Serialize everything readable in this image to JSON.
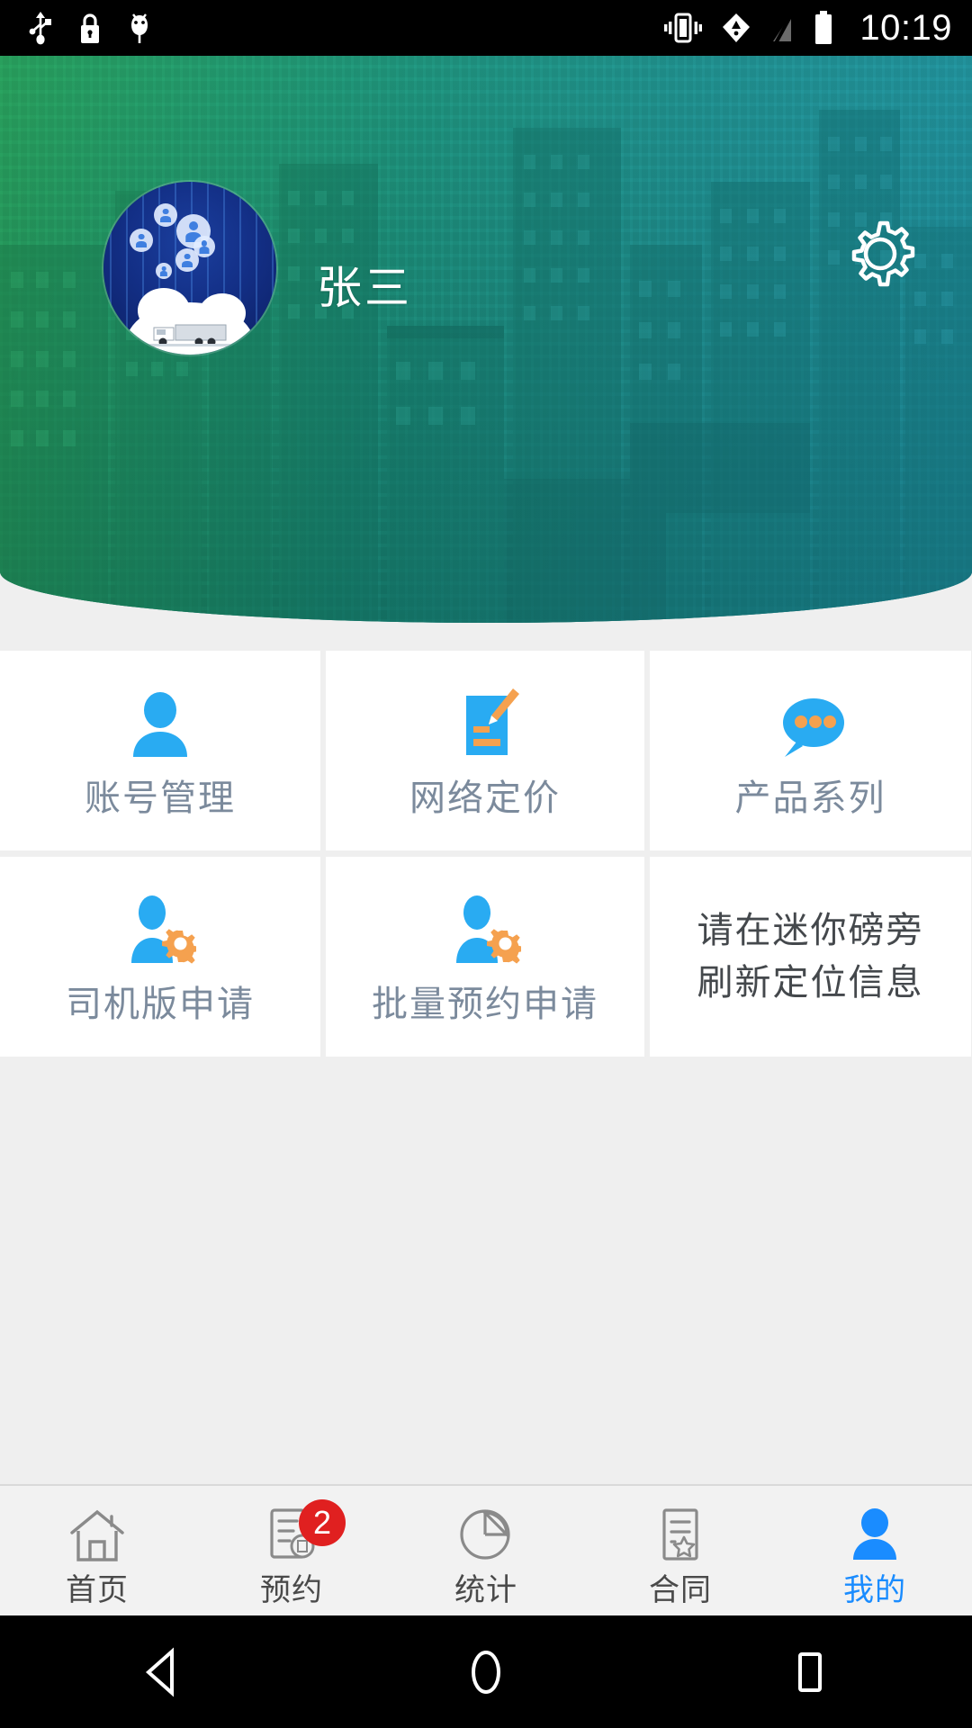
{
  "statusbar": {
    "time": "10:19",
    "left_icons": [
      "usb-icon",
      "lock-icon",
      "android-debug-icon"
    ],
    "right_icons": [
      "vibrate-icon",
      "wifi-icon",
      "signal-off-icon",
      "battery-icon"
    ]
  },
  "header": {
    "username": "张三",
    "avatar_name": "user-avatar",
    "settings_icon": "gear-icon",
    "gradient_from": "#20b05f",
    "gradient_to": "#20a0ba"
  },
  "grid": {
    "items": [
      {
        "label": "账号管理",
        "icon": "person-icon",
        "type": "icon"
      },
      {
        "label": "网络定价",
        "icon": "document-pencil-icon",
        "type": "icon"
      },
      {
        "label": "产品系列",
        "icon": "speech-bubble-icon",
        "type": "icon"
      },
      {
        "label": "司机版申请",
        "icon": "person-gear-icon",
        "type": "icon"
      },
      {
        "label": "批量预约申请",
        "icon": "person-gear-icon",
        "type": "icon"
      },
      {
        "label": "",
        "icon": "",
        "type": "text",
        "line1": "请在迷你磅旁",
        "line2": "刷新定位信息"
      }
    ],
    "label_color": "#7b8a9c",
    "note_color": "#44484c",
    "icon_blue": "#29abf2",
    "icon_orange": "#f5a14f"
  },
  "bottomnav": {
    "active_color": "#1a8cff",
    "inactive_color": "#4a4a4a",
    "badge_color": "#e02020",
    "items": [
      {
        "label": "首页",
        "icon": "home-icon",
        "active": false,
        "badge": ""
      },
      {
        "label": "预约",
        "icon": "appointment-doc-icon",
        "active": false,
        "badge": "2"
      },
      {
        "label": "统计",
        "icon": "pie-chart-icon",
        "active": false,
        "badge": ""
      },
      {
        "label": "合同",
        "icon": "contract-star-icon",
        "active": false,
        "badge": ""
      },
      {
        "label": "我的",
        "icon": "person-icon",
        "active": true,
        "badge": ""
      }
    ]
  },
  "androidbar": {
    "back_icon": "back-triangle-icon",
    "home_icon": "home-circle-icon",
    "recents_icon": "recents-square-icon"
  }
}
